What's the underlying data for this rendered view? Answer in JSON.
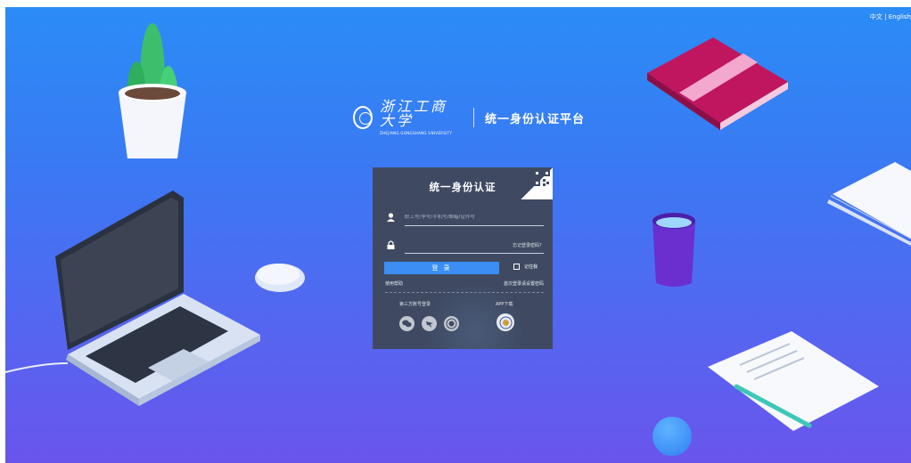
{
  "lang_switch": {
    "chinese": "中文",
    "separator": " | ",
    "english": "English"
  },
  "brand": {
    "university_cn": "浙江工商大学",
    "university_en": "ZHEJIANG GONGSHANG UNIVERSITY",
    "platform": "统一身份认证平台"
  },
  "login": {
    "title": "统一身份认证",
    "username_placeholder": "职工号/学号/手机号/邮箱/证件号",
    "password_placeholder": "",
    "forgot_password": "忘记登录密码？",
    "login_button": "登 录",
    "remember_label": "记住我",
    "help_link": "使用帮助",
    "first_login_link": "首次登录请设置密码",
    "third_party_label": "第三方账号登录",
    "app_download_label": "APP下载"
  },
  "icons": {
    "user": "user-icon",
    "lock": "lock-icon",
    "qr": "qr-code-icon",
    "wechat": "wechat-icon",
    "dingtalk": "dingtalk-icon",
    "university_seal": "university-seal-icon",
    "app": "app-download-icon"
  },
  "colors": {
    "background_top": "#2b8cf6",
    "background_bottom": "#6a55ec",
    "card": "#3f4a62",
    "button": "#3b8ef3"
  }
}
